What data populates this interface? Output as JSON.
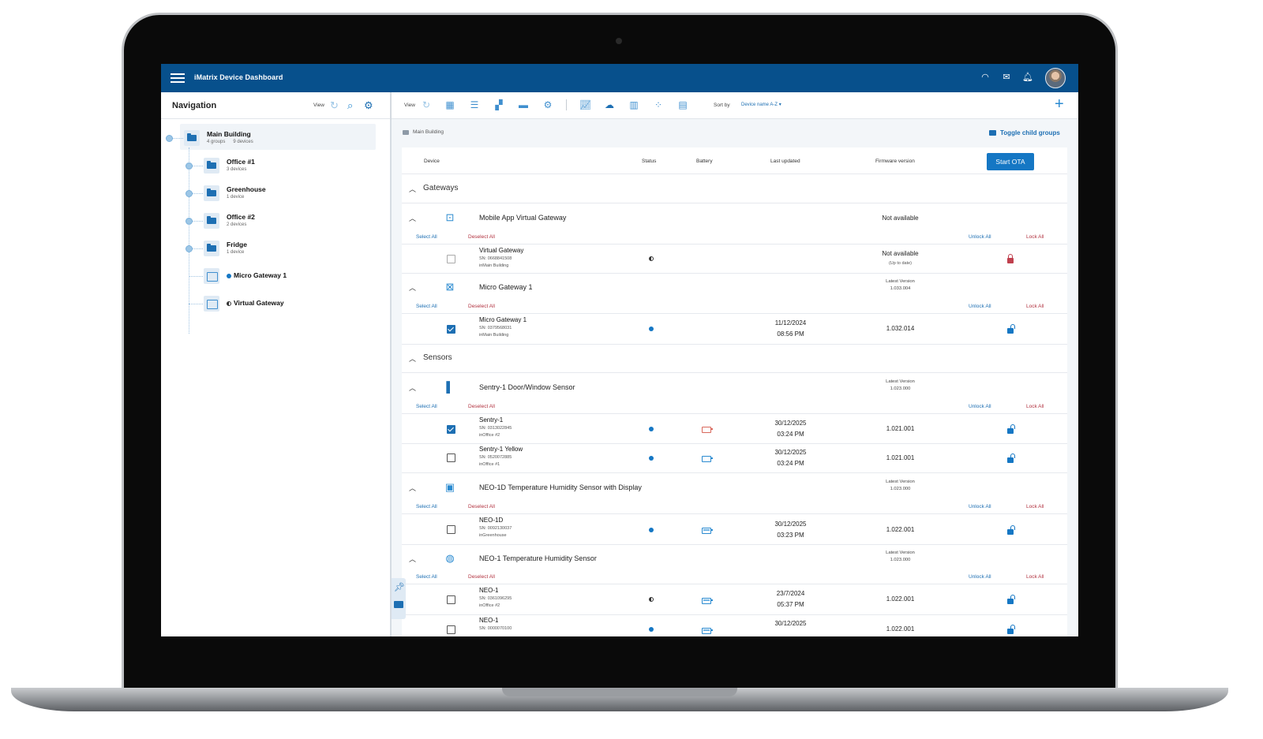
{
  "app": {
    "title": "iMatrix Device Dashboard"
  },
  "nav": {
    "title": "Navigation",
    "view_label": "View",
    "tree": [
      {
        "name": "Main Building",
        "sub1": "4 groups",
        "sub2": "9 devices"
      },
      {
        "name": "Office #1",
        "sub1": "3 devices"
      },
      {
        "name": "Greenhouse",
        "sub1": "1 device"
      },
      {
        "name": "Office #2",
        "sub1": "2 devices"
      },
      {
        "name": "Fridge",
        "sub1": "1 device"
      },
      {
        "name": "Micro Gateway 1"
      },
      {
        "name": "Virtual Gateway"
      }
    ]
  },
  "toolbar": {
    "view_label": "View",
    "sort_label": "Sort by",
    "sort_value": "Device name A-Z"
  },
  "breadcrumb": "Main Building",
  "toggle_child_groups": "Toggle child groups",
  "columns": {
    "device": "Device",
    "status": "Status",
    "battery": "Battery",
    "last_updated": "Last updated",
    "firmware": "Firmware version"
  },
  "start_ota": "Start OTA",
  "actions": {
    "select_all": "Select All",
    "deselect_all": "Deselect All",
    "unlock_all": "Unlock All",
    "lock_all": "Lock All"
  },
  "sections": [
    {
      "name": "Gateways",
      "types": [
        {
          "name": "Mobile App Virtual Gateway",
          "firmware_label": "Not available",
          "devices": [
            {
              "name": "Virtual Gateway",
              "sn": "SN: 0668841508",
              "loc": "inMain Building",
              "checked": false,
              "status": "unknown",
              "battery": null,
              "date": "",
              "time": "",
              "fw": "Not available",
              "fw_sub": "(Up to date)",
              "lock": "closed"
            }
          ]
        },
        {
          "name": "Micro Gateway 1",
          "latest_label": "Latest Version",
          "latest_version": "1.033.004",
          "devices": [
            {
              "name": "Micro Gateway 1",
              "sn": "SN: 0379568031",
              "loc": "inMain Building",
              "checked": true,
              "status": "online",
              "battery": null,
              "date": "11/12/2024",
              "time": "08:56 PM",
              "fw": "1.032.014",
              "lock": "open"
            }
          ]
        }
      ]
    },
    {
      "name": "Sensors",
      "types": [
        {
          "name": "Sentry-1 Door/Window Sensor",
          "latest_label": "Latest Version",
          "latest_version": "1.023.000",
          "devices": [
            {
              "name": "Sentry-1",
              "sn": "SN: 0313022845",
              "loc": "inOffice #2",
              "checked": true,
              "status": "online",
              "battery": "low",
              "date": "30/12/2025",
              "time": "03:24 PM",
              "fw": "1.021.001",
              "lock": "open"
            },
            {
              "name": "Sentry-1 Yellow",
              "sn": "SN: 0520072885",
              "loc": "inOffice #1",
              "checked": false,
              "status": "online",
              "battery": "mid",
              "date": "30/12/2025",
              "time": "03:24 PM",
              "fw": "1.021.001",
              "lock": "open"
            }
          ]
        },
        {
          "name": "NEO-1D Temperature Humidity Sensor with Display",
          "latest_label": "Latest Version",
          "latest_version": "1.023.000",
          "devices": [
            {
              "name": "NEO-1D",
              "sn": "SN: 0092130037",
              "loc": "inGreenhouse",
              "checked": false,
              "status": "online",
              "battery": "full",
              "date": "30/12/2025",
              "time": "03:23 PM",
              "fw": "1.022.001",
              "lock": "open"
            }
          ]
        },
        {
          "name": "NEO-1 Temperature Humidity Sensor",
          "latest_label": "Latest Version",
          "latest_version": "1.023.000",
          "devices": [
            {
              "name": "NEO-1",
              "sn": "SN: 0361096295",
              "loc": "inOffice #2",
              "checked": false,
              "status": "unknown",
              "battery": "full",
              "date": "23/7/2024",
              "time": "05:37 PM",
              "fw": "1.022.001",
              "lock": "open"
            },
            {
              "name": "NEO-1",
              "sn": "SN: 0000070100",
              "loc": "",
              "checked": false,
              "status": "online",
              "battery": "full",
              "date": "30/12/2025",
              "time": "",
              "fw": "1.022.001",
              "lock": "open"
            }
          ]
        }
      ]
    }
  ]
}
